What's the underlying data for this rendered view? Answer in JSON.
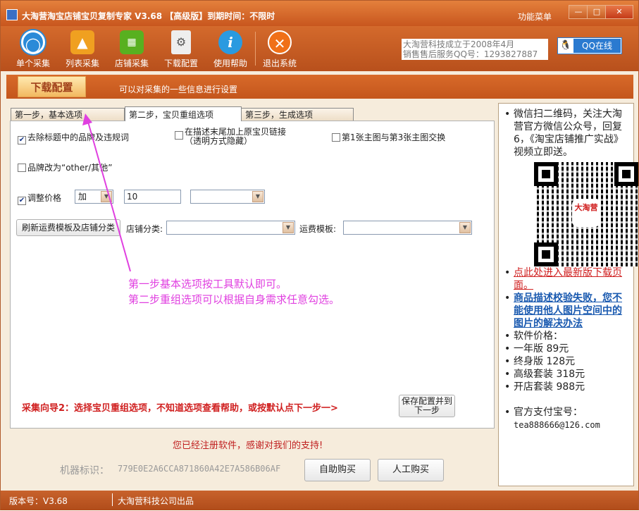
{
  "window": {
    "title": "大淘营淘宝店铺宝贝复制专家 V3.68 【高级版】到期时间：不限时",
    "function_menu": "功能菜单",
    "min_label": "—",
    "max_label": "□",
    "close_label": "✕"
  },
  "toolbar": {
    "items": [
      {
        "label": "单个采集",
        "icon": "single-collect-icon",
        "color": "#2a8ad8"
      },
      {
        "label": "列表采集",
        "icon": "list-collect-icon",
        "color": "#f0a020"
      },
      {
        "label": "店铺采集",
        "icon": "store-collect-icon",
        "color": "#58b020"
      },
      {
        "label": "下载配置",
        "icon": "download-config-icon",
        "color": "#e8e8e8"
      },
      {
        "label": "使用帮助",
        "icon": "help-icon",
        "color": "#2a9ae0"
      },
      {
        "label": "退出系统",
        "icon": "exit-icon",
        "color": "#f07018"
      }
    ],
    "company_line1": "大淘营科技成立于2008年4月",
    "company_line2": "销售售后服务QQ号：1293827887",
    "qq_button": "QQ在线"
  },
  "section": {
    "tab": "下载配置",
    "description": "可以对采集的一些信息进行设置"
  },
  "tabs": [
    {
      "label": "第一步，基本选项"
    },
    {
      "label": "第二步，宝贝重组选项"
    },
    {
      "label": "第三步，生成选项"
    }
  ],
  "options": {
    "remove_words": {
      "label": "去除标题中的品牌及违规词",
      "checked": true
    },
    "append_link": {
      "label": "在描述末尾加上原宝贝链接（透明方式隐藏）",
      "checked": false
    },
    "swap_images": {
      "label": "第1张主图与第3张主图交换",
      "checked": false
    },
    "brand_other": {
      "label": "品牌改为“other/其他”",
      "checked": false
    },
    "adjust_price": {
      "label": "调整价格",
      "checked": true,
      "mode": "加",
      "value": "10",
      "unit": ""
    },
    "refresh_button": "刷新运费模板及店铺分类",
    "shop_category_label": "店铺分类:",
    "shop_category_value": "",
    "freight_label": "运费模板:",
    "freight_value": ""
  },
  "annotation": {
    "line1": "第一步基本选项按工具默认即可。",
    "line2": "第二步重组选项可以根据自身需求任意勾选。"
  },
  "wizard_text": "采集向导2：选择宝贝重组选项，不知道选项查看帮助，或按默认点下一步一>",
  "save_button": {
    "line1": "保存配置并到",
    "line2": "下一步"
  },
  "registered_msg": "您已经注册软件，感谢对我们的支持!",
  "machine_id_label": "机器标识：",
  "machine_id": "779E0E2A6CCA871860A42E7A586B06AF",
  "buy_self": "自助购买",
  "buy_manual": "人工购买",
  "side": {
    "wechat": "微信扫二维码，关注大淘营官方微信公众号，回复6，《淘宝店铺推广实战》视频立即送。",
    "qr_logo": "大淘营",
    "latest_link": "点此处进入最新版下载页面。",
    "verify_link": "商品描述校验失败，您不能使用他人图片空间中的图片的解决办法",
    "price_title": "软件价格：",
    "prices": [
      "一年版 89元",
      "终身版 128元",
      "高级套装 318元",
      "开店套装 988元"
    ],
    "alipay_title": "官方支付宝号：",
    "alipay": "tea888666@126.com"
  },
  "status": {
    "version": "版本号：V3.68",
    "maker": "大淘营科技公司出品"
  }
}
